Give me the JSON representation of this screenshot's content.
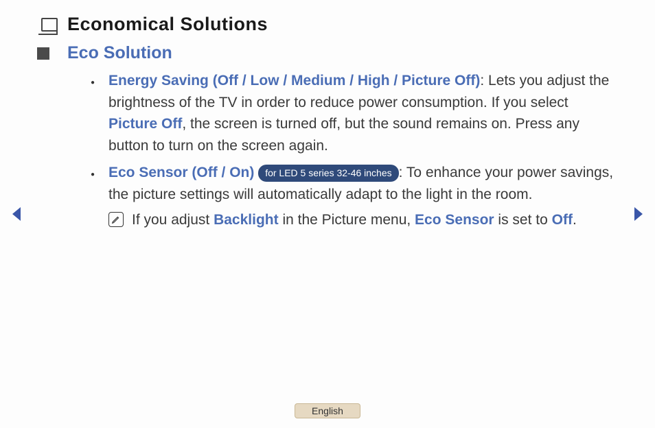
{
  "page_title": "Economical Solutions",
  "section": {
    "title": "Eco Solution",
    "items": [
      {
        "heading": "Energy Saving (Off / Low / Medium / High / Picture Off)",
        "desc_before": ": Lets you adjust the brightness of the TV in order to reduce power consumption. If you select ",
        "inline_link": "Picture Off",
        "desc_after": ", the screen is turned off, but the sound remains on. Press any button to turn on the screen again."
      },
      {
        "heading": "Eco Sensor (Off / On)",
        "badge": "for LED 5 series 32-46 inches",
        "desc": ": To enhance your power savings, the picture settings will automatically adapt to the light in the room.",
        "note_prefix": "If you adjust ",
        "note_link1": "Backlight",
        "note_mid": " in the Picture menu, ",
        "note_link2": "Eco Sensor",
        "note_mid2": " is set to ",
        "note_link3": "Off",
        "note_end": "."
      }
    ]
  },
  "language": "English"
}
